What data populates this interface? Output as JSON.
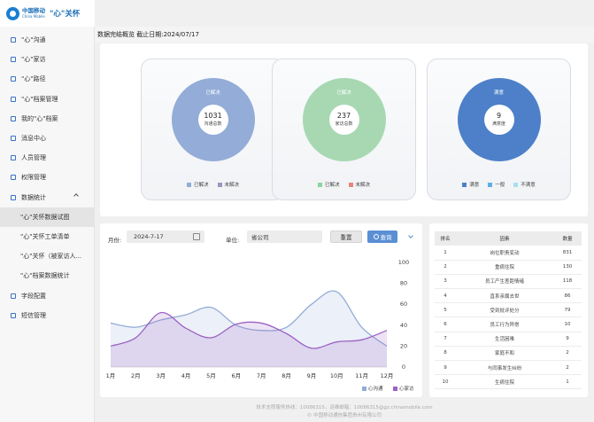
{
  "brand": {
    "name_cn": "中国移动",
    "name_en": "China Mobile",
    "app_title": "\"心\"关怀"
  },
  "sidebar": {
    "items": [
      {
        "label": "\"心\"沟通",
        "icon": "chat-icon"
      },
      {
        "label": "\"心\"家访",
        "icon": "visit-icon"
      },
      {
        "label": "\"心\"路径",
        "icon": "path-icon"
      },
      {
        "label": "\"心\"档案管理",
        "icon": "archive-icon"
      },
      {
        "label": "我的\"心\"档案",
        "icon": "profile-icon"
      },
      {
        "label": "消息中心",
        "icon": "message-icon"
      },
      {
        "label": "人员管理",
        "icon": "user-icon"
      },
      {
        "label": "权限管理",
        "icon": "permission-icon"
      },
      {
        "label": "数据统计",
        "icon": "stats-icon",
        "expanded": true
      }
    ],
    "subitems": [
      {
        "label": "\"心\"关怀数据试图",
        "active": true
      },
      {
        "label": "\"心\"关怀工单清单",
        "active": false
      },
      {
        "label": "\"心\"关怀（被家访人...",
        "active": false
      },
      {
        "label": "\"心\"档案数据统计",
        "active": false
      }
    ],
    "items_after": [
      {
        "label": "字段配置",
        "icon": "field-config-icon"
      },
      {
        "label": "短信管理",
        "icon": "sms-icon"
      }
    ]
  },
  "header": {
    "title": "数据完结概览 截止日期:2024/07/17"
  },
  "summary_cards": [
    {
      "top_label": "已解决",
      "value": "1031",
      "label": "沟通总数",
      "ring_color": "#93acd8",
      "legend": [
        {
          "label": "已解决",
          "color": "#93acd8"
        },
        {
          "label": "未解决",
          "color": "#9e94c0"
        }
      ]
    },
    {
      "top_label": "已解决",
      "value": "237",
      "label": "家访总数",
      "ring_color": "#a7d8b2",
      "legend": [
        {
          "label": "已解决",
          "color": "#8fd39f"
        },
        {
          "label": "未解决",
          "color": "#e9857a"
        }
      ]
    },
    {
      "top_label": "满意",
      "value": "9",
      "label": "满意度",
      "ring_color": "#4d80c9",
      "legend": [
        {
          "label": "满意",
          "color": "#4d80c9"
        },
        {
          "label": "一般",
          "color": "#5fb0e6"
        },
        {
          "label": "不满意",
          "color": "#a9dff2"
        }
      ]
    }
  ],
  "filters": {
    "month_label": "月份:",
    "month_value": "2024-7-17",
    "unit_label": "单位:",
    "unit_value": "省公司",
    "reset_label": "重置",
    "query_label": "查询"
  },
  "chart_data": {
    "type": "line",
    "x": [
      "1月",
      "2月",
      "3月",
      "4月",
      "5月",
      "6月",
      "7月",
      "8月",
      "9月",
      "10月",
      "11月",
      "12月"
    ],
    "series": [
      {
        "name": "心沟通",
        "color": "#93acd8",
        "values": [
          42,
          38,
          45,
          50,
          57,
          40,
          35,
          38,
          60,
          72,
          38,
          20
        ]
      },
      {
        "name": "心家访",
        "color": "#9b62c4",
        "values": [
          20,
          28,
          52,
          37,
          28,
          41,
          42,
          32,
          18,
          24,
          26,
          35
        ]
      }
    ],
    "ylim": [
      0,
      100
    ],
    "yticks": [
      "0",
      "20",
      "40",
      "60",
      "80",
      "100"
    ],
    "legend_position": "bottom-right",
    "grid": false
  },
  "table": {
    "headers": [
      "排名",
      "因素",
      "数量"
    ],
    "rows": [
      [
        "1",
        "岗位职责变动",
        "831"
      ],
      [
        "2",
        "重病住院",
        "130"
      ],
      [
        "3",
        "员工产生差距情绪",
        "118"
      ],
      [
        "4",
        "直系亲属去世",
        "86"
      ],
      [
        "5",
        "受到批评处分",
        "79"
      ],
      [
        "6",
        "员工行为异常",
        "10"
      ],
      [
        "7",
        "生活困难",
        "9"
      ],
      [
        "8",
        "家庭不和",
        "2"
      ],
      [
        "9",
        "与同事发生纠纷",
        "2"
      ],
      [
        "10",
        "生病住院",
        "1"
      ]
    ]
  },
  "footer": {
    "line1": "技术支撑服务热线：10086315，运维邮箱：10086315@gz.chinamobile.com",
    "line2": "© 中国移动通信集团贵州有限公司"
  }
}
